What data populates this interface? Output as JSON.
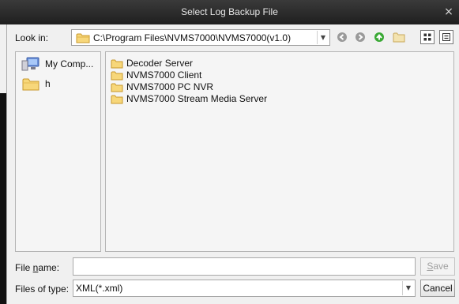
{
  "window": {
    "title": "Select Log Backup File",
    "close_glyph": "×"
  },
  "look_in": {
    "label": "Look in:",
    "path": "C:\\Program Files\\NVMS7000\\NVMS7000(v1.0)",
    "icon": "folder-icon"
  },
  "toolbar": {
    "buttons": [
      {
        "name": "back-button",
        "icon": "back-arrow-icon"
      },
      {
        "name": "forward-button",
        "icon": "forward-arrow-icon"
      },
      {
        "name": "up-button",
        "icon": "up-arrow-icon"
      },
      {
        "name": "new-folder-button",
        "icon": "new-folder-icon"
      },
      {
        "name": "list-view-button",
        "icon": "list-view-icon"
      },
      {
        "name": "detail-view-button",
        "icon": "detail-view-icon"
      }
    ]
  },
  "places": [
    {
      "label": "My Comp...",
      "icon": "computer-icon"
    },
    {
      "label": "h",
      "icon": "folder-icon"
    }
  ],
  "files": [
    {
      "label": "Decoder Server",
      "icon": "folder-icon"
    },
    {
      "label": "NVMS7000 Client",
      "icon": "folder-icon"
    },
    {
      "label": "NVMS7000 PC NVR",
      "icon": "folder-icon"
    },
    {
      "label": "NVMS7000 Stream Media Server",
      "icon": "folder-icon"
    }
  ],
  "file_name": {
    "label_prefix": "File ",
    "label_underlined": "n",
    "label_suffix": "ame:",
    "value": "",
    "placeholder": ""
  },
  "file_type": {
    "label": "Files of type:",
    "value": "XML(*.xml)"
  },
  "buttons": {
    "save_prefix": "",
    "save_underlined": "S",
    "save_suffix": "ave",
    "cancel": "Cancel"
  },
  "colors": {
    "titlebar": "#2a2a2a",
    "folder_yellow": "#f2c94c",
    "nav_green": "#3aa935",
    "nav_gray": "#8a8a8a"
  }
}
